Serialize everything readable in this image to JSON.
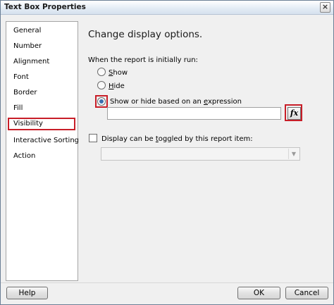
{
  "window": {
    "title": "Text Box Properties",
    "close_glyph": "×"
  },
  "sidebar": {
    "items": [
      {
        "label": "General",
        "selected": false
      },
      {
        "label": "Number",
        "selected": false
      },
      {
        "label": "Alignment",
        "selected": false
      },
      {
        "label": "Font",
        "selected": false
      },
      {
        "label": "Border",
        "selected": false
      },
      {
        "label": "Fill",
        "selected": false
      },
      {
        "label": "Visibility",
        "selected": true
      },
      {
        "label": "Interactive Sorting",
        "selected": false
      },
      {
        "label": "Action",
        "selected": false
      }
    ]
  },
  "main": {
    "heading": "Change display options.",
    "initial_label": "When the report is initially run:",
    "options": {
      "show": {
        "prefix": "",
        "accel": "S",
        "suffix": "how",
        "checked": false
      },
      "hide": {
        "prefix": "",
        "accel": "H",
        "suffix": "ide",
        "checked": false
      },
      "expression": {
        "prefix": "Show or hide based on an ",
        "accel": "e",
        "suffix": "xpression",
        "checked": true
      }
    },
    "expression_value": "",
    "fx_button": "fx",
    "toggle_checkbox": {
      "prefix": "Display can be ",
      "accel": "t",
      "suffix": "oggled by this report item:",
      "checked": false
    },
    "toggle_select_value": ""
  },
  "footer": {
    "help": "Help",
    "ok": "OK",
    "cancel": "Cancel"
  },
  "colors": {
    "highlight": "#c81e28",
    "radio_dot": "#3a6fb0",
    "title_gradient": "#e4ecf5"
  }
}
